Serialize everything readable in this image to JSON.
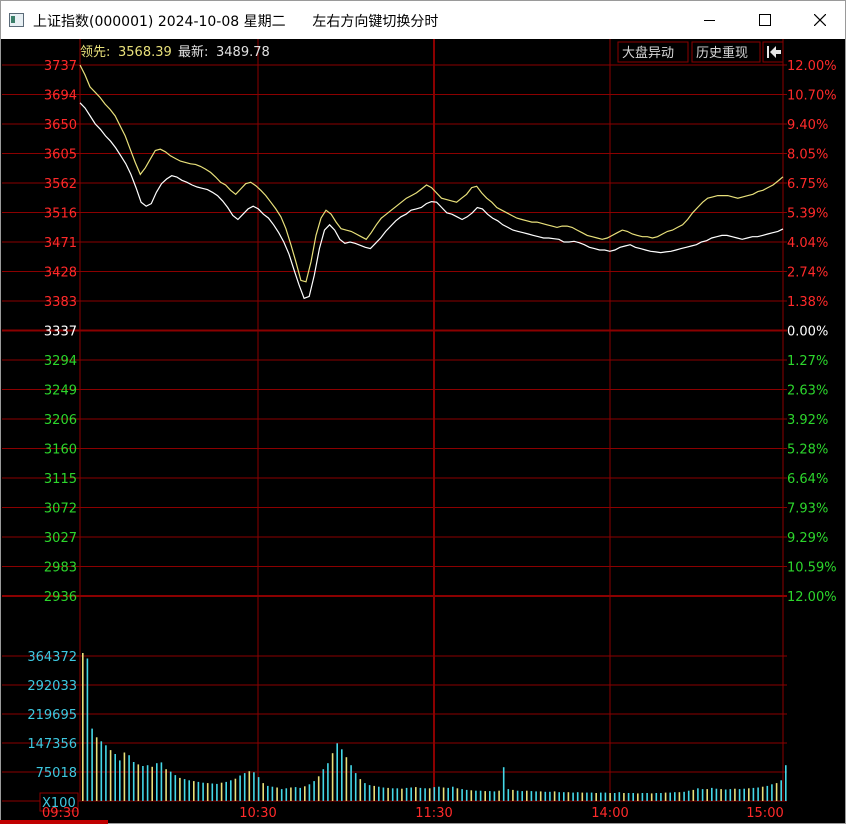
{
  "window": {
    "title": "上证指数(000001) 2024-10-08 星期二      左右方向键切换分时"
  },
  "header": {
    "lead_label": "领先:",
    "lead_value": "3568.39",
    "latest_label": "最新:",
    "latest_value": "3489.78",
    "buttons": [
      "大盘异动",
      "历史重现"
    ]
  },
  "colors": {
    "grid": "#8b0000",
    "up": "#ff2a2a",
    "down": "#2cd62c",
    "neutral": "#ffffff",
    "lead_line": "#e8e07a",
    "price_line": "#ffffff",
    "volume_up": "#e8e07a",
    "volume_down": "#44d8e8",
    "volume_axis": "#3ec8e0"
  },
  "chart_data": {
    "type": "line",
    "title": "",
    "price_axis_left": [
      "3737",
      "3694",
      "3650",
      "3605",
      "3562",
      "3516",
      "3471",
      "3428",
      "3383",
      "3337",
      "3294",
      "3249",
      "3206",
      "3160",
      "3115",
      "3072",
      "3027",
      "2983",
      "2936"
    ],
    "percent_axis_right": [
      "12.00%",
      "10.70%",
      "9.40%",
      "8.05%",
      "6.75%",
      "5.39%",
      "4.04%",
      "2.74%",
      "1.38%",
      "0.00%",
      "1.27%",
      "2.63%",
      "3.92%",
      "5.28%",
      "6.64%",
      "7.93%",
      "9.29%",
      "10.59%",
      "12.00%"
    ],
    "volume_axis": [
      "364372",
      "292033",
      "219695",
      "147356",
      "75018"
    ],
    "volume_unit": "X100",
    "time_labels": [
      "09:30",
      "10:30",
      "11:30",
      "14:00",
      "15:00"
    ],
    "ylim": [
      2936,
      3737
    ],
    "prev_close": 3337,
    "series": [
      {
        "values": [
          3680,
          3672,
          3660,
          3648,
          3640,
          3630,
          3622,
          3612,
          3600,
          3588,
          3572,
          3552,
          3530,
          3524,
          3528,
          3545,
          3558,
          3565,
          3570,
          3568,
          3563,
          3560,
          3556,
          3553,
          3551,
          3549,
          3545,
          3540,
          3532,
          3522,
          3510,
          3504,
          3512,
          3520,
          3524,
          3520,
          3512,
          3506,
          3496,
          3484,
          3470,
          3452,
          3428,
          3405,
          3385,
          3388,
          3420,
          3460,
          3488,
          3496,
          3488,
          3474,
          3468,
          3470,
          3468,
          3465,
          3462,
          3460,
          3468,
          3476,
          3486,
          3494,
          3502,
          3508,
          3512,
          3518,
          3520,
          3522,
          3528,
          3531,
          3530,
          3522,
          3514,
          3512,
          3508,
          3504,
          3508,
          3514,
          3522,
          3520,
          3512,
          3506,
          3502,
          3496,
          3492,
          3488,
          3486,
          3484,
          3482,
          3480,
          3478,
          3476,
          3476,
          3475,
          3474,
          3470,
          3470,
          3471,
          3469,
          3466,
          3462,
          3460,
          3458,
          3458,
          3456,
          3458,
          3462,
          3464,
          3466,
          3462,
          3460,
          3458,
          3456,
          3455,
          3454,
          3455,
          3456,
          3458,
          3460,
          3462,
          3464,
          3466,
          3470,
          3472,
          3476,
          3478,
          3480,
          3480,
          3478,
          3476,
          3474,
          3476,
          3478,
          3478,
          3480,
          3482,
          3484,
          3486,
          3489.78
        ]
      },
      {
        "values": [
          3737,
          3722,
          3704,
          3696,
          3688,
          3678,
          3670,
          3660,
          3645,
          3630,
          3610,
          3590,
          3572,
          3582,
          3595,
          3608,
          3610,
          3606,
          3600,
          3596,
          3592,
          3590,
          3588,
          3587,
          3584,
          3580,
          3575,
          3568,
          3560,
          3556,
          3548,
          3542,
          3550,
          3558,
          3560,
          3555,
          3548,
          3540,
          3530,
          3520,
          3508,
          3490,
          3466,
          3440,
          3412,
          3410,
          3440,
          3480,
          3506,
          3518,
          3512,
          3500,
          3490,
          3488,
          3486,
          3482,
          3478,
          3474,
          3484,
          3496,
          3506,
          3512,
          3518,
          3524,
          3530,
          3536,
          3540,
          3544,
          3550,
          3556,
          3552,
          3544,
          3536,
          3534,
          3532,
          3530,
          3536,
          3542,
          3552,
          3554,
          3544,
          3536,
          3530,
          3522,
          3518,
          3514,
          3510,
          3506,
          3504,
          3502,
          3500,
          3500,
          3498,
          3496,
          3494,
          3492,
          3494,
          3494,
          3492,
          3488,
          3484,
          3480,
          3478,
          3476,
          3474,
          3476,
          3480,
          3484,
          3488,
          3486,
          3482,
          3480,
          3478,
          3478,
          3476,
          3478,
          3482,
          3486,
          3488,
          3492,
          3496,
          3504,
          3514,
          3522,
          3530,
          3536,
          3538,
          3540,
          3540,
          3540,
          3538,
          3536,
          3538,
          3540,
          3542,
          3546,
          3548,
          3552,
          3556,
          3562,
          3568.39
        ]
      }
    ],
    "volumes": [
      372000,
      358000,
      182000,
      160000,
      150000,
      140000,
      128000,
      118000,
      102000,
      122000,
      115000,
      98000,
      92000,
      88000,
      90000,
      86000,
      95000,
      97000,
      80000,
      74000,
      65000,
      58000,
      55000,
      52000,
      50000,
      48000,
      46000,
      45000,
      44000,
      43000,
      46000,
      48000,
      52000,
      56000,
      64000,
      70000,
      75000,
      72000,
      60000,
      45000,
      38000,
      36000,
      34000,
      30000,
      32000,
      34000,
      35000,
      33000,
      37000,
      42000,
      50000,
      62000,
      80000,
      95000,
      120000,
      145000,
      130000,
      110000,
      90000,
      70000,
      55000,
      45000,
      40000,
      38000,
      36000,
      34000,
      33000,
      32000,
      32000,
      31000,
      33000,
      34000,
      35000,
      33000,
      32000,
      32000,
      35000,
      36000,
      34000,
      33000,
      36000,
      32000,
      30000,
      28000,
      27000,
      26000,
      26000,
      25000,
      25000,
      24000,
      26000,
      85000,
      30000,
      28000,
      26000,
      25000,
      26000,
      25000,
      24000,
      24000,
      23000,
      23000,
      24000,
      22000,
      22000,
      22000,
      21000,
      22000,
      21000,
      21000,
      21000,
      20000,
      21000,
      21000,
      20000,
      20000,
      22000,
      20000,
      20000,
      20000,
      19000,
      20000,
      20000,
      19000,
      20000,
      20000,
      21000,
      21000,
      22000,
      22000,
      23000,
      26000,
      28000,
      32000,
      30000,
      30000,
      33000,
      31000,
      30000,
      29000,
      30000,
      31000,
      30000,
      31000,
      32000,
      33000,
      34000,
      36000,
      38000,
      42000,
      45000,
      52000,
      90000
    ]
  }
}
